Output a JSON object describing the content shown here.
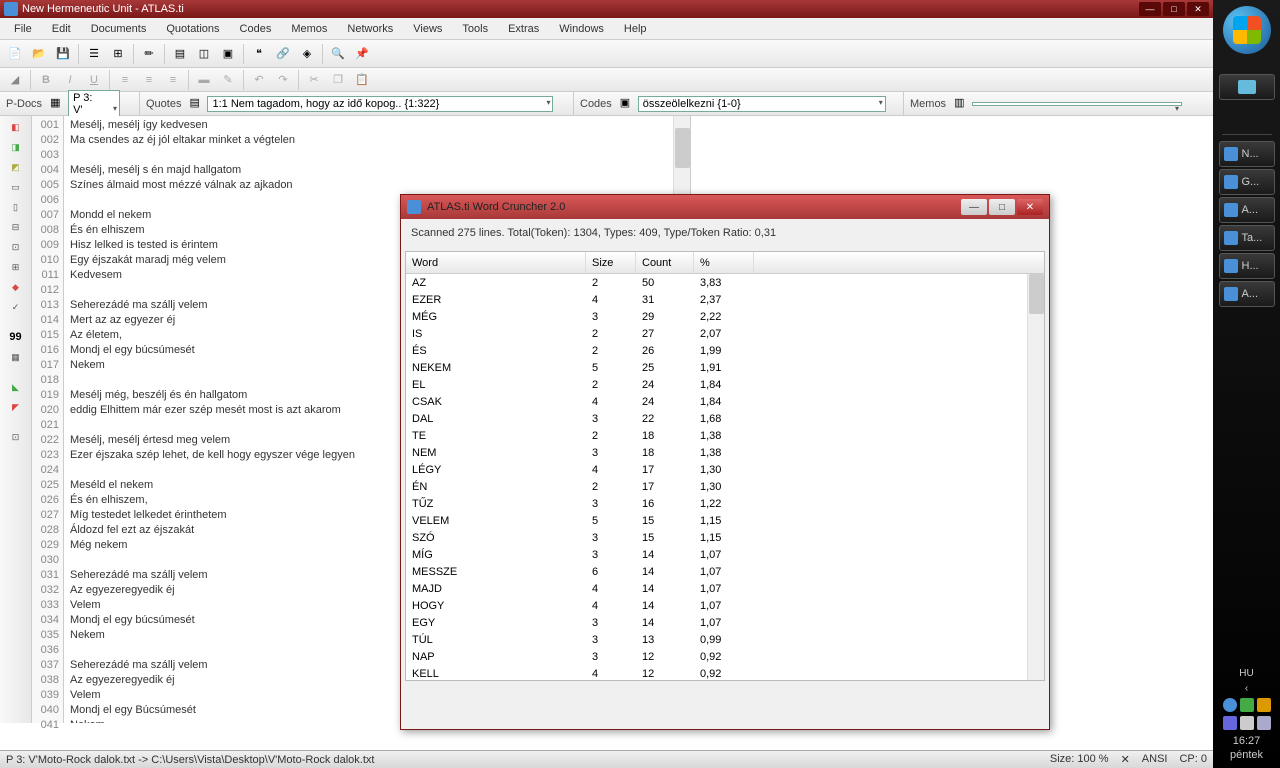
{
  "window": {
    "title": "New Hermeneutic Unit - ATLAS.ti"
  },
  "menu": [
    "File",
    "Edit",
    "Documents",
    "Quotations",
    "Codes",
    "Memos",
    "Networks",
    "Views",
    "Tools",
    "Extras",
    "Windows",
    "Help"
  ],
  "nav": {
    "pdocs_label": "P-Docs",
    "pdocs_value": "P 3: V'",
    "quotes_label": "Quotes",
    "quotes_value": "1:1 Nem tagadom, hogy az idő kopog.. {1:322}",
    "codes_label": "Codes",
    "codes_value": "összeölelkezni {1-0}",
    "memos_label": "Memos",
    "memos_value": ""
  },
  "lines": [
    {
      "n": "001",
      "t": "Mesélj, mesélj így kedvesen"
    },
    {
      "n": "002",
      "t": "Ma csendes az éj jól eltakar minket a végtelen"
    },
    {
      "n": "003",
      "t": ""
    },
    {
      "n": "004",
      "t": "Mesélj, mesélj s én majd hallgatom"
    },
    {
      "n": "005",
      "t": "Színes álmaid most mézzé válnak az ajkadon"
    },
    {
      "n": "006",
      "t": ""
    },
    {
      "n": "007",
      "t": "Mondd el nekem"
    },
    {
      "n": "008",
      "t": "És én elhiszem"
    },
    {
      "n": "009",
      "t": "Hisz lelked is tested is érintem"
    },
    {
      "n": "010",
      "t": "Egy éjszakát maradj még velem"
    },
    {
      "n": "011",
      "t": "Kedvesem"
    },
    {
      "n": "012",
      "t": ""
    },
    {
      "n": "013",
      "t": "Seherezádé ma szállj velem"
    },
    {
      "n": "014",
      "t": "Mert az az egyezer éj"
    },
    {
      "n": "015",
      "t": "Az életem,"
    },
    {
      "n": "016",
      "t": "Mondj el egy búcsúmesét"
    },
    {
      "n": "017",
      "t": "Nekem"
    },
    {
      "n": "018",
      "t": ""
    },
    {
      "n": "019",
      "t": "Mesélj még, beszélj és én hallgatom"
    },
    {
      "n": "020",
      "t": "eddig Elhittem már ezer szép mesét most is azt akarom"
    },
    {
      "n": "021",
      "t": ""
    },
    {
      "n": "022",
      "t": "Mesélj, mesélj értesd meg velem"
    },
    {
      "n": "023",
      "t": "Ezer éjszaka szép lehet, de kell hogy egyszer vége legyen"
    },
    {
      "n": "024",
      "t": ""
    },
    {
      "n": "025",
      "t": "Meséld el nekem"
    },
    {
      "n": "026",
      "t": "És én elhiszem,"
    },
    {
      "n": "027",
      "t": "Míg testedet lelkedet érinthetem"
    },
    {
      "n": "028",
      "t": "Áldozd fel ezt az éjszakát"
    },
    {
      "n": "029",
      "t": "Még nekem"
    },
    {
      "n": "030",
      "t": ""
    },
    {
      "n": "031",
      "t": "Seherezádé ma szállj velem"
    },
    {
      "n": "032",
      "t": "Az egyezeregyedik éj"
    },
    {
      "n": "033",
      "t": "Velem"
    },
    {
      "n": "034",
      "t": "Mondj el egy búcsúmesét"
    },
    {
      "n": "035",
      "t": "Nekem"
    },
    {
      "n": "036",
      "t": ""
    },
    {
      "n": "037",
      "t": "Seherezádé ma szállj velem"
    },
    {
      "n": "038",
      "t": "Az egyezeregyedik éj"
    },
    {
      "n": "039",
      "t": "Velem"
    },
    {
      "n": "040",
      "t": "Mondj el egy Búcsúmesét"
    },
    {
      "n": "041",
      "t": "Nekem"
    }
  ],
  "dialog": {
    "title": "ATLAS.ti Word Cruncher 2.0",
    "info": "Scanned 275 lines. Total(Token): 1304, Types: 409, Type/Token Ratio: 0,31",
    "headers": {
      "word": "Word",
      "size": "Size",
      "count": "Count",
      "pct": "%"
    },
    "rows": [
      {
        "w": "AZ",
        "s": "2",
        "c": "50",
        "p": "3,83"
      },
      {
        "w": "EZER",
        "s": "4",
        "c": "31",
        "p": "2,37"
      },
      {
        "w": "MÉG",
        "s": "3",
        "c": "29",
        "p": "2,22"
      },
      {
        "w": "IS",
        "s": "2",
        "c": "27",
        "p": "2,07"
      },
      {
        "w": "ÉS",
        "s": "2",
        "c": "26",
        "p": "1,99"
      },
      {
        "w": "NEKEM",
        "s": "5",
        "c": "25",
        "p": "1,91"
      },
      {
        "w": "EL",
        "s": "2",
        "c": "24",
        "p": "1,84"
      },
      {
        "w": "CSAK",
        "s": "4",
        "c": "24",
        "p": "1,84"
      },
      {
        "w": "DAL",
        "s": "3",
        "c": "22",
        "p": "1,68"
      },
      {
        "w": "TE",
        "s": "2",
        "c": "18",
        "p": "1,38"
      },
      {
        "w": "NEM",
        "s": "3",
        "c": "18",
        "p": "1,38"
      },
      {
        "w": "LÉGY",
        "s": "4",
        "c": "17",
        "p": "1,30"
      },
      {
        "w": "ÉN",
        "s": "2",
        "c": "17",
        "p": "1,30"
      },
      {
        "w": "TŰZ",
        "s": "3",
        "c": "16",
        "p": "1,22"
      },
      {
        "w": "VELEM",
        "s": "5",
        "c": "15",
        "p": "1,15"
      },
      {
        "w": "SZÓ",
        "s": "3",
        "c": "15",
        "p": "1,15"
      },
      {
        "w": "MÍG",
        "s": "3",
        "c": "14",
        "p": "1,07"
      },
      {
        "w": "MESSZE",
        "s": "6",
        "c": "14",
        "p": "1,07"
      },
      {
        "w": "MAJD",
        "s": "4",
        "c": "14",
        "p": "1,07"
      },
      {
        "w": "HOGY",
        "s": "4",
        "c": "14",
        "p": "1,07"
      },
      {
        "w": "EGY",
        "s": "3",
        "c": "14",
        "p": "1,07"
      },
      {
        "w": "TÚL",
        "s": "3",
        "c": "13",
        "p": "0,99"
      },
      {
        "w": "NAP",
        "s": "3",
        "c": "12",
        "p": "0,92"
      },
      {
        "w": "KELL",
        "s": "4",
        "c": "12",
        "p": "0,92"
      }
    ]
  },
  "status": {
    "left": "P 3: V'Moto-Rock dalok.txt -> C:\\Users\\Vista\\Desktop\\V'Moto-Rock dalok.txt",
    "size": "Size: 100 %",
    "enc": "ANSI",
    "cp": "CP: 0"
  },
  "taskbar": {
    "items": [
      "N...",
      "G...",
      "A...",
      "Ta...",
      "H...",
      "A..."
    ],
    "lang": "HU",
    "time": "16:27",
    "day": "péntek"
  },
  "sidebar_99": "99"
}
